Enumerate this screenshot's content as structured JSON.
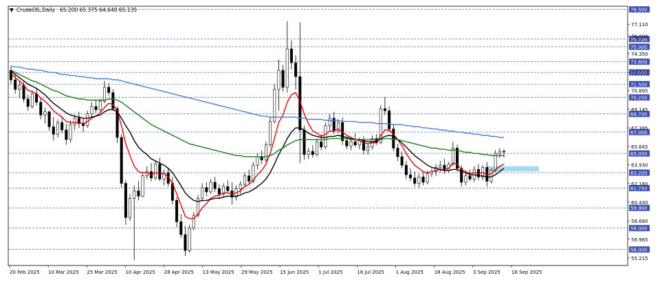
{
  "header": {
    "marker": "▼",
    "symbol": "CrudeOIL,Daily",
    "ohlc": "65.200 65.375 64.640 65.135"
  },
  "colors": {
    "bull_candle": "#ffffff",
    "bear_candle": "#000000",
    "ema_fast": "#e00000",
    "ema_mid": "#000000",
    "ma_slow": "#1a7a1a",
    "ma_long": "#4a7cd6",
    "level_line": "#3a4fb0",
    "level_label_bg": "#3a4fb0",
    "zone": "#a9d9ea",
    "background": "#ffffff"
  },
  "chart_data": {
    "type": "candlestick",
    "symbol": "CrudeOIL",
    "timeframe": "Daily",
    "ylim": [
      54.5,
      78.8
    ],
    "x_tick_labels": [
      "20 Feb 2025",
      "10 Mar 2025",
      "25 Mar 2025",
      "10 Apr 2025",
      "28 Apr 2025",
      "13 May 2025",
      "29 May 2025",
      "15 Jun 2025",
      "1 Jul 2025",
      "16 Jul 2025",
      "1 Aug 2025",
      "18 Aug 2025",
      "3 Sep 2025",
      "18 Sep 2025"
    ],
    "y_ticks": [
      77.11,
      76.0,
      74.35,
      72.6,
      70.895,
      69.145,
      67.395,
      65.645,
      63.93,
      62.18,
      60.43,
      58.68,
      56.965,
      55.215
    ],
    "levels": [
      78.5,
      75.72,
      75.0,
      73.6,
      72.6,
      71.5,
      70.25,
      68.7,
      67.0,
      65.0,
      63.2,
      61.75,
      59.9,
      58.0,
      56.0
    ],
    "zone": {
      "from": 63.32,
      "to": 63.8
    },
    "candles": [
      [
        72.8,
        73.2,
        71.5,
        71.9
      ],
      [
        71.9,
        72.5,
        70.6,
        71.0
      ],
      [
        71.0,
        71.8,
        70.2,
        71.4
      ],
      [
        71.4,
        71.7,
        69.8,
        70.1
      ],
      [
        70.1,
        70.5,
        69.0,
        69.4
      ],
      [
        69.4,
        70.9,
        69.2,
        70.6
      ],
      [
        70.6,
        71.1,
        69.5,
        69.8
      ],
      [
        69.8,
        70.2,
        68.2,
        68.6
      ],
      [
        68.6,
        69.3,
        67.8,
        68.9
      ],
      [
        68.9,
        69.0,
        67.1,
        67.5
      ],
      [
        67.5,
        68.4,
        66.2,
        66.8
      ],
      [
        66.8,
        68.2,
        66.5,
        67.9
      ],
      [
        67.9,
        68.5,
        66.9,
        67.2
      ],
      [
        67.2,
        67.8,
        65.8,
        66.3
      ],
      [
        66.3,
        68.1,
        66.0,
        67.7
      ],
      [
        67.7,
        68.6,
        67.2,
        68.3
      ],
      [
        68.3,
        68.9,
        67.4,
        67.8
      ],
      [
        67.8,
        68.3,
        67.0,
        67.6
      ],
      [
        67.6,
        69.0,
        67.4,
        68.7
      ],
      [
        68.7,
        69.8,
        68.4,
        69.4
      ],
      [
        69.4,
        70.0,
        68.8,
        69.1
      ],
      [
        69.1,
        70.1,
        68.9,
        69.9
      ],
      [
        69.9,
        71.8,
        69.7,
        71.2
      ],
      [
        71.2,
        71.6,
        70.4,
        70.7
      ],
      [
        70.7,
        71.0,
        69.0,
        69.2
      ],
      [
        69.2,
        69.4,
        66.0,
        66.5
      ],
      [
        66.5,
        66.8,
        61.8,
        62.2
      ],
      [
        62.2,
        62.5,
        58.3,
        59.0
      ],
      [
        59.0,
        61.2,
        58.7,
        60.8
      ],
      [
        60.8,
        62.0,
        55.0,
        61.5
      ],
      [
        61.5,
        62.4,
        60.6,
        61.0
      ],
      [
        61.0,
        63.2,
        60.9,
        62.9
      ],
      [
        62.9,
        63.8,
        62.6,
        63.3
      ],
      [
        63.3,
        64.1,
        62.4,
        62.7
      ],
      [
        62.7,
        64.3,
        62.5,
        64.0
      ],
      [
        64.0,
        64.6,
        62.4,
        62.6
      ],
      [
        62.6,
        63.5,
        62.0,
        63.2
      ],
      [
        63.2,
        63.6,
        61.9,
        62.2
      ],
      [
        62.2,
        62.8,
        60.2,
        60.6
      ],
      [
        60.6,
        60.9,
        58.1,
        58.6
      ],
      [
        58.6,
        59.3,
        57.1,
        57.4
      ],
      [
        57.4,
        58.2,
        55.4,
        55.9
      ],
      [
        55.9,
        58.3,
        55.7,
        58.0
      ],
      [
        58.0,
        59.5,
        57.8,
        59.2
      ],
      [
        59.2,
        61.1,
        59.0,
        60.8
      ],
      [
        60.8,
        62.2,
        60.5,
        61.8
      ],
      [
        61.8,
        62.3,
        61.0,
        61.4
      ],
      [
        61.4,
        62.6,
        61.2,
        62.3
      ],
      [
        62.3,
        62.8,
        61.4,
        61.7
      ],
      [
        61.7,
        62.1,
        60.8,
        61.2
      ],
      [
        61.2,
        62.2,
        60.9,
        61.9
      ],
      [
        61.9,
        62.5,
        61.3,
        61.5
      ],
      [
        61.5,
        62.3,
        60.2,
        60.9
      ],
      [
        60.9,
        62.0,
        60.6,
        61.7
      ],
      [
        61.7,
        62.4,
        61.2,
        62.1
      ],
      [
        62.1,
        63.2,
        61.9,
        62.9
      ],
      [
        62.9,
        63.5,
        62.1,
        62.4
      ],
      [
        62.4,
        64.2,
        62.2,
        63.9
      ],
      [
        63.9,
        65.0,
        63.5,
        64.7
      ],
      [
        64.7,
        65.3,
        64.0,
        64.4
      ],
      [
        64.4,
        66.1,
        64.2,
        65.8
      ],
      [
        65.8,
        68.4,
        65.6,
        68.0
      ],
      [
        68.0,
        71.5,
        67.8,
        71.0
      ],
      [
        71.0,
        73.8,
        69.0,
        72.8
      ],
      [
        72.8,
        73.3,
        70.8,
        71.2
      ],
      [
        71.2,
        77.4,
        70.7,
        74.8
      ],
      [
        74.8,
        75.6,
        72.9,
        73.5
      ],
      [
        73.5,
        74.2,
        71.0,
        72.2
      ],
      [
        72.2,
        77.3,
        64.1,
        67.2
      ],
      [
        67.2,
        67.6,
        64.4,
        64.9
      ],
      [
        64.9,
        65.5,
        64.5,
        65.2
      ],
      [
        65.2,
        65.8,
        64.6,
        64.9
      ],
      [
        64.9,
        66.4,
        64.7,
        66.1
      ],
      [
        66.1,
        66.8,
        65.3,
        65.6
      ],
      [
        65.6,
        67.9,
        65.4,
        67.6
      ],
      [
        67.6,
        68.7,
        67.2,
        68.3
      ],
      [
        68.3,
        68.9,
        66.8,
        67.1
      ],
      [
        67.1,
        68.2,
        66.9,
        67.9
      ],
      [
        67.9,
        68.4,
        65.8,
        66.2
      ],
      [
        66.2,
        66.6,
        65.4,
        65.7
      ],
      [
        65.7,
        66.3,
        65.3,
        66.1
      ],
      [
        66.1,
        66.9,
        65.6,
        65.8
      ],
      [
        65.8,
        66.5,
        65.4,
        66.2
      ],
      [
        66.2,
        66.6,
        64.9,
        65.3
      ],
      [
        65.3,
        65.9,
        64.9,
        65.6
      ],
      [
        65.6,
        66.7,
        65.4,
        66.4
      ],
      [
        66.4,
        66.8,
        65.8,
        66.0
      ],
      [
        66.0,
        69.5,
        65.9,
        69.2
      ],
      [
        69.2,
        70.3,
        68.6,
        69.0
      ],
      [
        69.0,
        69.4,
        67.0,
        67.3
      ],
      [
        67.3,
        67.7,
        65.2,
        65.5
      ],
      [
        65.5,
        65.9,
        64.3,
        64.7
      ],
      [
        64.7,
        65.2,
        63.6,
        63.9
      ],
      [
        63.9,
        64.3,
        62.6,
        63.0
      ],
      [
        63.0,
        63.6,
        62.4,
        62.7
      ],
      [
        62.7,
        63.3,
        61.9,
        62.2
      ],
      [
        62.2,
        63.1,
        61.8,
        62.8
      ],
      [
        62.8,
        63.3,
        62.0,
        62.3
      ],
      [
        62.3,
        63.4,
        62.1,
        63.1
      ],
      [
        63.1,
        63.6,
        62.8,
        63.3
      ],
      [
        63.3,
        64.0,
        62.9,
        63.7
      ],
      [
        63.7,
        64.3,
        63.2,
        63.9
      ],
      [
        63.9,
        64.5,
        63.1,
        63.4
      ],
      [
        63.4,
        64.2,
        63.2,
        64.0
      ],
      [
        64.0,
        66.1,
        63.8,
        65.5
      ],
      [
        65.5,
        65.8,
        63.3,
        63.6
      ],
      [
        63.6,
        63.9,
        61.9,
        62.3
      ],
      [
        62.3,
        63.3,
        62.0,
        62.9
      ],
      [
        62.9,
        63.5,
        62.4,
        62.6
      ],
      [
        62.6,
        63.8,
        62.3,
        63.5
      ],
      [
        63.5,
        64.0,
        62.5,
        62.8
      ],
      [
        62.8,
        63.9,
        62.5,
        63.7
      ],
      [
        63.7,
        64.2,
        61.9,
        62.4
      ],
      [
        62.4,
        63.6,
        62.2,
        63.4
      ],
      [
        63.4,
        65.3,
        63.2,
        65.0
      ],
      [
        65.0,
        65.5,
        64.6,
        65.2
      ],
      [
        65.2,
        65.4,
        64.6,
        65.14
      ]
    ],
    "ma_series": [
      {
        "color_key": "ema_fast",
        "values": [
          72.5,
          72.1,
          71.8,
          71.4,
          70.9,
          70.8,
          70.6,
          70.2,
          69.9,
          69.5,
          69.0,
          68.7,
          68.4,
          68.0,
          67.9,
          67.9,
          67.9,
          67.8,
          68.0,
          68.3,
          68.5,
          68.8,
          69.3,
          69.7,
          69.6,
          69.0,
          67.6,
          65.9,
          64.8,
          63.8,
          63.3,
          63.2,
          63.2,
          63.0,
          63.2,
          63.1,
          63.1,
          62.8,
          62.2,
          61.2,
          60.2,
          59.1,
          58.9,
          58.9,
          59.3,
          59.9,
          60.3,
          60.8,
          61.0,
          61.1,
          61.3,
          61.3,
          61.2,
          61.3,
          61.5,
          61.9,
          62.1,
          62.5,
          63.0,
          63.4,
          64.0,
          65.0,
          66.4,
          67.9,
          68.6,
          69.8,
          70.5,
          70.7,
          69.9,
          68.7,
          67.8,
          67.1,
          66.9,
          66.6,
          66.8,
          67.1,
          67.1,
          67.3,
          67.0,
          66.7,
          66.5,
          66.3,
          66.2,
          66.0,
          65.9,
          66.0,
          66.0,
          66.7,
          67.2,
          67.2,
          66.8,
          66.3,
          65.7,
          65.0,
          64.4,
          63.9,
          63.6,
          63.3,
          63.2,
          63.3,
          63.4,
          63.5,
          63.5,
          63.6,
          64.1,
          64.0,
          63.5,
          63.3,
          63.1,
          63.2,
          63.1,
          63.2,
          63.0,
          63.1,
          63.5,
          63.8,
          64.0
        ]
      },
      {
        "color_key": "ema_mid",
        "values": [
          72.7,
          72.4,
          72.1,
          71.8,
          71.5,
          71.3,
          71.1,
          70.8,
          70.5,
          70.1,
          69.7,
          69.4,
          69.1,
          68.8,
          68.6,
          68.5,
          68.4,
          68.3,
          68.3,
          68.4,
          68.5,
          68.6,
          68.9,
          69.1,
          69.1,
          68.9,
          68.3,
          67.6,
          67.0,
          66.2,
          65.6,
          65.2,
          64.9,
          64.5,
          64.3,
          64.1,
          63.9,
          63.6,
          63.2,
          62.6,
          62.0,
          61.3,
          60.9,
          60.6,
          60.5,
          60.6,
          60.6,
          60.7,
          60.8,
          60.8,
          60.9,
          61.0,
          61.0,
          61.0,
          61.1,
          61.3,
          61.4,
          61.6,
          61.9,
          62.2,
          62.6,
          63.2,
          64.0,
          64.9,
          65.6,
          66.4,
          67.0,
          67.4,
          67.4,
          67.2,
          66.9,
          66.7,
          66.6,
          66.5,
          66.5,
          66.6,
          66.6,
          66.7,
          66.6,
          66.5,
          66.4,
          66.3,
          66.3,
          66.2,
          66.1,
          66.1,
          66.1,
          66.4,
          66.6,
          66.7,
          66.6,
          66.3,
          66.0,
          65.6,
          65.2,
          64.8,
          64.5,
          64.2,
          63.9,
          63.7,
          63.6,
          63.5,
          63.4,
          63.4,
          63.5,
          63.5,
          63.3,
          63.2,
          63.0,
          63.0,
          62.9,
          62.9,
          62.8,
          62.8,
          63.0,
          63.3,
          63.6
        ]
      },
      {
        "color_key": "ma_slow",
        "values": [
          72.8,
          72.6,
          72.4,
          72.2,
          72.0,
          71.8,
          71.7,
          71.5,
          71.3,
          71.1,
          70.9,
          70.8,
          70.6,
          70.4,
          70.3,
          70.2,
          70.1,
          70.1,
          70.0,
          70.0,
          70.0,
          70.0,
          70.0,
          70.1,
          70.1,
          70.0,
          69.8,
          69.5,
          69.2,
          68.9,
          68.6,
          68.3,
          68.0,
          67.7,
          67.5,
          67.3,
          67.1,
          66.9,
          66.7,
          66.5,
          66.3,
          66.1,
          65.9,
          65.8,
          65.7,
          65.6,
          65.5,
          65.4,
          65.3,
          65.2,
          65.1,
          65.0,
          64.9,
          64.8,
          64.8,
          64.7,
          64.7,
          64.7,
          64.7,
          64.7,
          64.7,
          64.8,
          65.0,
          65.3,
          65.5,
          65.8,
          66.0,
          66.2,
          66.3,
          66.3,
          66.3,
          66.3,
          66.3,
          66.3,
          66.3,
          66.4,
          66.4,
          66.4,
          66.4,
          66.4,
          66.3,
          66.3,
          66.3,
          66.3,
          66.3,
          66.3,
          66.3,
          66.3,
          66.4,
          66.4,
          66.3,
          66.3,
          66.2,
          66.1,
          66.0,
          65.9,
          65.8,
          65.7,
          65.6,
          65.5,
          65.5,
          65.4,
          65.4,
          65.3,
          65.3,
          65.3,
          65.2,
          65.1,
          65.1,
          65.0,
          65.0,
          64.9,
          64.9,
          64.8,
          64.8,
          64.8,
          64.8
        ]
      },
      {
        "color_key": "ma_long",
        "values": [
          73.2,
          73.1,
          73.1,
          73.0,
          72.9,
          72.9,
          72.8,
          72.8,
          72.7,
          72.6,
          72.6,
          72.5,
          72.4,
          72.4,
          72.3,
          72.3,
          72.2,
          72.2,
          72.1,
          72.1,
          72.0,
          72.0,
          72.0,
          72.0,
          71.9,
          71.9,
          71.8,
          71.7,
          71.6,
          71.5,
          71.4,
          71.3,
          71.2,
          71.1,
          71.0,
          70.9,
          70.8,
          70.7,
          70.6,
          70.5,
          70.4,
          70.3,
          70.2,
          70.1,
          70.0,
          69.9,
          69.8,
          69.7,
          69.6,
          69.5,
          69.4,
          69.3,
          69.2,
          69.1,
          69.0,
          68.9,
          68.8,
          68.7,
          68.6,
          68.5,
          68.5,
          68.4,
          68.4,
          68.4,
          68.4,
          68.4,
          68.4,
          68.4,
          68.3,
          68.3,
          68.2,
          68.2,
          68.2,
          68.2,
          68.1,
          68.1,
          68.1,
          68.1,
          68.0,
          68.0,
          68.0,
          68.0,
          67.9,
          67.9,
          67.9,
          67.9,
          67.8,
          67.8,
          67.8,
          67.8,
          67.7,
          67.7,
          67.7,
          67.6,
          67.6,
          67.5,
          67.5,
          67.4,
          67.4,
          67.3,
          67.3,
          67.2,
          67.2,
          67.1,
          67.1,
          67.0,
          67.0,
          66.9,
          66.9,
          66.8,
          66.8,
          66.7,
          66.7,
          66.6,
          66.6,
          66.5,
          66.5
        ]
      }
    ]
  }
}
